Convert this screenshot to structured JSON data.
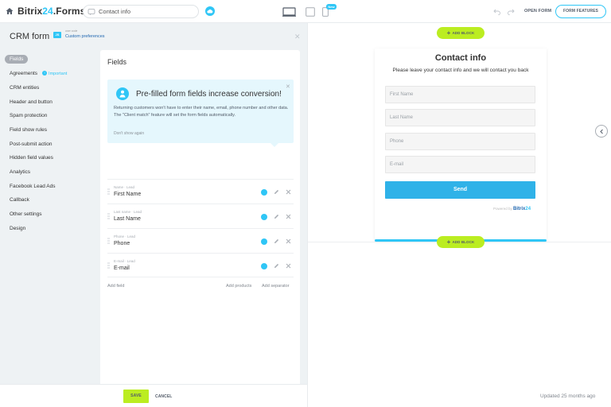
{
  "header": {
    "brand_main": "Bitrix",
    "brand_accent": "24",
    "brand_suffix": ".Forms",
    "form_title": "Contact info",
    "new_badge": "New",
    "open_form": "OPEN FORM",
    "form_features": "FORM FEATURES"
  },
  "panel": {
    "title": "CRM form",
    "user_code_label": "user code",
    "custom_preferences": "Custom preferences"
  },
  "menu": {
    "items": [
      "Fields",
      "Agreements",
      "CRM entities",
      "Header and button",
      "Spam protection",
      "Field show rules",
      "Post-submit action",
      "Hidden field values",
      "Analytics",
      "Facebook Lead Ads",
      "Callback",
      "Other settings",
      "Design"
    ],
    "important_badge": "!",
    "important_text": "Important"
  },
  "fields_card": {
    "title": "Fields",
    "hint_title": "Pre-filled form fields increase conversion!",
    "hint_text": "Returning customers won't have to enter their name, email, phone number and other data. The \"Client match\" feature will set the form fields automatically.",
    "hint_dont_show": "Don't show again",
    "rows": [
      {
        "meta": "Name · Lead",
        "name": "First Name"
      },
      {
        "meta": "Last name · Lead",
        "name": "Last Name"
      },
      {
        "meta": "Phone · Lead",
        "name": "Phone"
      },
      {
        "meta": "E-mail · Lead",
        "name": "E-mail"
      }
    ],
    "add_field": "Add field",
    "add_products": "Add products",
    "add_separator": "Add separator"
  },
  "footer": {
    "save": "SAVE",
    "cancel": "CANCEL"
  },
  "preview": {
    "add_block": "ADD BLOCK",
    "form_title": "Contact info",
    "form_subtitle": "Please leave your contact info and we will contact you back",
    "placeholders": [
      "First Name",
      "Last Name",
      "Phone",
      "E-mail"
    ],
    "send": "Send",
    "powered_by": "Powered by",
    "powered_brand_main": "Bitrix",
    "powered_brand_accent": "24",
    "updated": "Updated 25 months ago"
  },
  "colors": {
    "accent": "#2fc6f6",
    "save_green": "#bbed21",
    "send_blue": "#2fb2e8",
    "panel_bg": "#eef2f4"
  }
}
